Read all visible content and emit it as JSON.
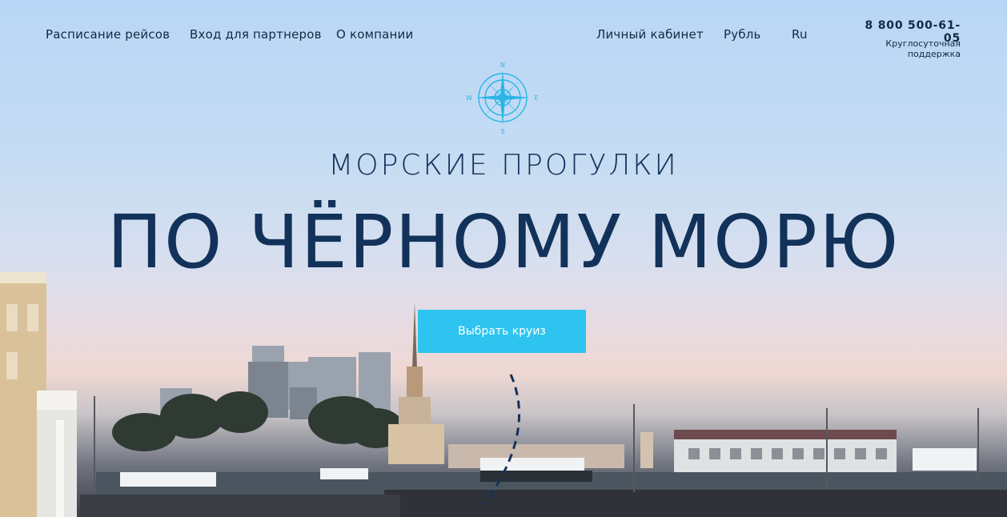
{
  "nav": {
    "left": [
      "Расписание рейсов",
      "Вход для партнеров",
      "О компании"
    ],
    "right": [
      "Личный кабинет",
      "Рубль",
      "Ru"
    ]
  },
  "contact": {
    "phone": "8 800 500-61-05",
    "support": "Круглосуточная поддержка"
  },
  "compass": {
    "n": "N",
    "s": "S",
    "w": "W",
    "e": "E"
  },
  "hero": {
    "subtitle": "МОРСКИЕ ПРОГУЛКИ",
    "title": "ПО ЧЁРНОМУ МОРЮ",
    "cta": "Выбрать круиз"
  },
  "colors": {
    "accent": "#2ec4ef",
    "text": "#12325a"
  }
}
